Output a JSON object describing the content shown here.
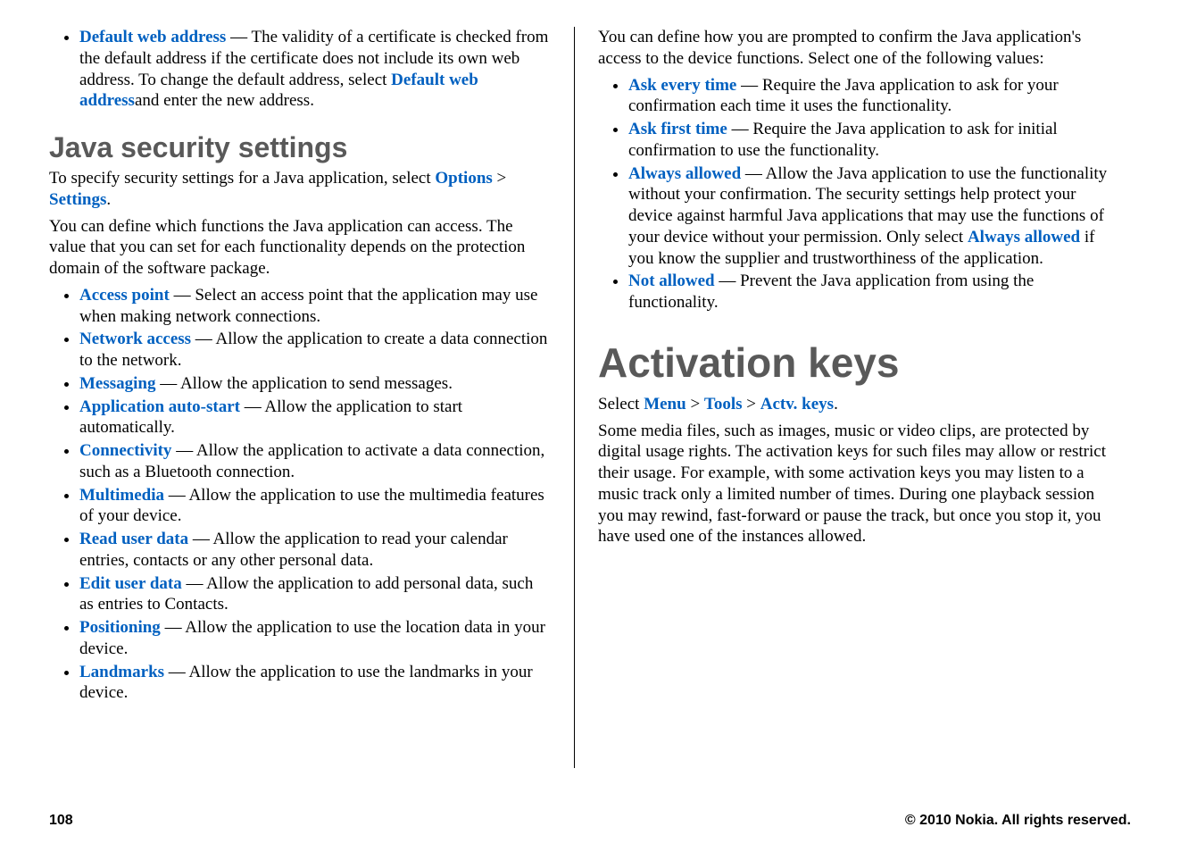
{
  "footer": {
    "page_number": "108",
    "copyright": "© 2010 Nokia. All rights reserved."
  },
  "left": {
    "default_web_item": {
      "term": "Default web address",
      "sep": "  — ",
      "text_a": "The validity of a certificate is checked from the default address if the certificate does not include its own web address. To change the default address, select ",
      "inline_term": "Default web address",
      "text_b": "and enter the new address."
    },
    "java_heading": "Java security settings",
    "java_intro": {
      "text_a": "To specify security settings for a Java application, select ",
      "path1": "Options",
      "sep": " > ",
      "path2": "Settings",
      "period": "."
    },
    "java_para": "You can define which functions the Java application can access. The value that you can set for each functionality depends on the protection domain of the software package.",
    "java_items": [
      {
        "term": "Access point",
        "text": " — Select an access point that the application may use when making network connections."
      },
      {
        "term": "Network access",
        "text": "  — Allow the application to create a data connection to the network."
      },
      {
        "term": "Messaging",
        "text": "  — Allow the application to send messages."
      },
      {
        "term": "Application auto-start",
        "text": "  — Allow the application to start automatically."
      },
      {
        "term": "Connectivity",
        "text": "  — Allow the application to activate a data connection, such as a Bluetooth connection."
      },
      {
        "term": "Multimedia",
        "text": "  — Allow the application to use the multimedia features of your device."
      },
      {
        "term": "Read user data",
        "text": "  — Allow the application to read your calendar entries, contacts or any other personal data."
      },
      {
        "term": "Edit user data",
        "text": "  — Allow the application to add personal data, such as entries to Contacts."
      },
      {
        "term": "Positioning",
        "text": "  — Allow the application to use the location data in your device."
      },
      {
        "term": "Landmarks",
        "text": " — Allow the application to use the landmarks in your device."
      }
    ]
  },
  "right": {
    "prompt_para": "You can define how you are prompted to confirm the Java application's access to the device functions. Select one of the following values:",
    "prompt_items": [
      {
        "term": "Ask every time",
        "text": "  — Require the Java application to ask for your confirmation each time it uses the functionality."
      },
      {
        "term": "Ask first time",
        "text": "  — Require the Java application to ask for initial confirmation to use the functionality."
      }
    ],
    "always_item": {
      "term": "Always allowed",
      "text_a": "  — Allow the Java application to use the functionality without your confirmation. The security settings help protect your device against harmful Java applications that may use the functions of your device without your permission. Only select ",
      "inline_term": "Always allowed",
      "text_b": " if you know the supplier and trustworthiness of the application."
    },
    "notallowed_item": {
      "term": "Not allowed",
      "text": "  — Prevent the Java application from using the functionality."
    },
    "actv_heading": "Activation keys",
    "actv_path": {
      "prefix": "Select ",
      "p1": "Menu",
      "sep1": " > ",
      "p2": "Tools",
      "sep2": " > ",
      "p3": "Actv. keys",
      "period": "."
    },
    "actv_para": "Some media files, such as images, music or video clips, are protected by digital usage rights. The activation keys for such files may allow or restrict their usage. For example, with some activation keys you may listen to a music track only a limited number of times. During one playback session you may rewind, fast-forward or pause the track, but once you stop it, you have used one of the instances allowed."
  }
}
